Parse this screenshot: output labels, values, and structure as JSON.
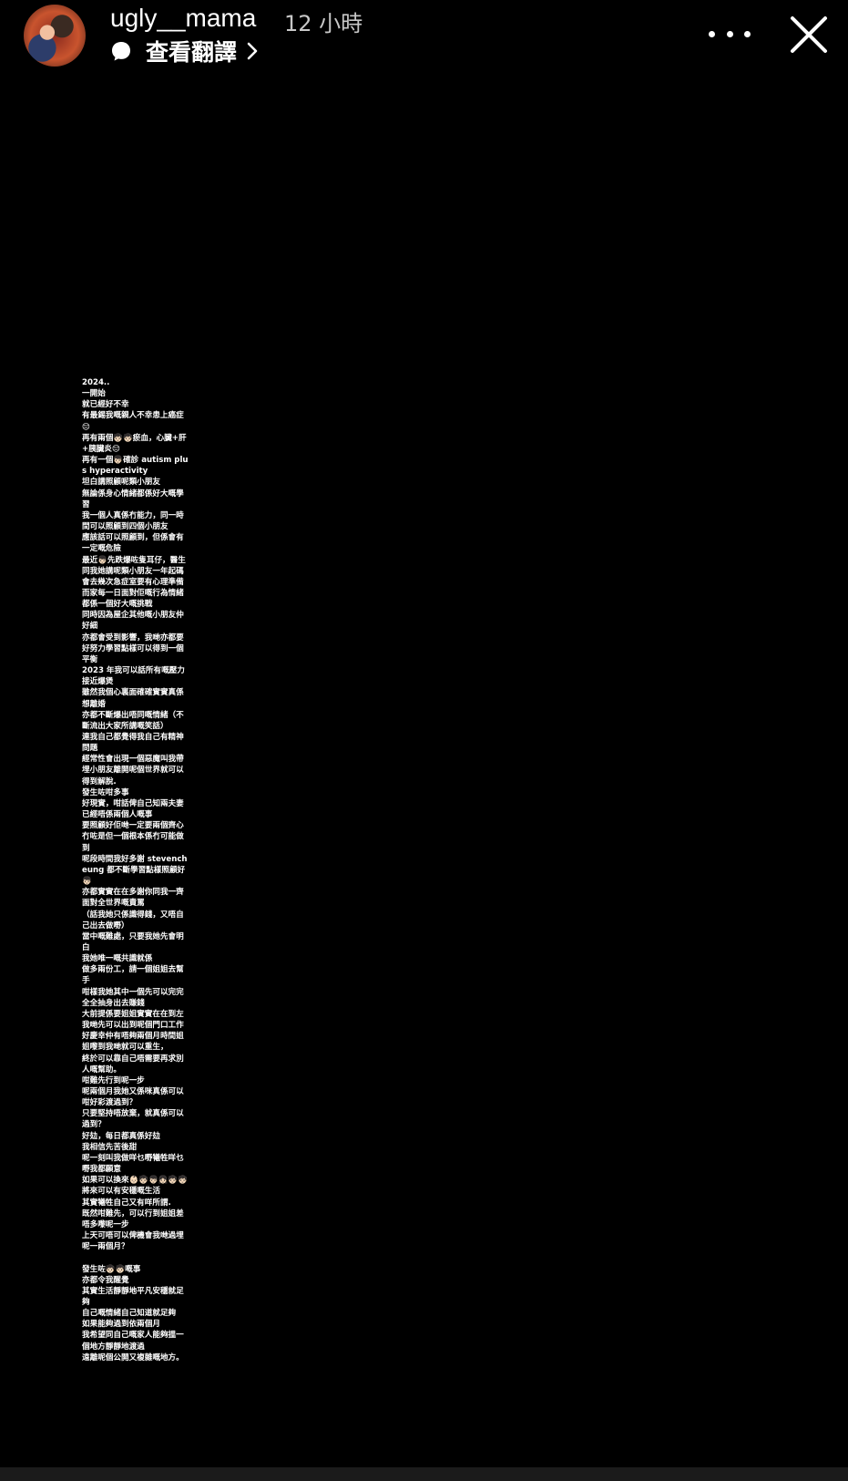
{
  "header": {
    "username": "ugly__mama",
    "time_ago": "12 小時",
    "translate_label": "查看翻譯",
    "icons": {
      "more": "more-horizontal-icon",
      "close": "close-icon",
      "translate": "speech-bubble-icon",
      "chevron": "chevron-right-icon"
    }
  },
  "story": {
    "text": "2024..\n一開始\n就已經好不幸\n有最錫我嘅親人不幸患上癌症😔\n再有兩個🧒🏻🧒🏻瘀血，心臟+肝+胰臟炎😔\n再有一個👦🏻確診 autism plus hyperactivity\n坦白講照顧呢類小朋友\n無論係身心情緒都係好大嘅學習\n我一個人真係冇能力，同一時間可以照顧到四個小朋友\n應該話可以照顧到，但係會有一定嘅危險\n最近👦🏻先跌爆咗隻耳仔，醫生同我她講呢類小朋友一年起碼會去幾次急症室要有心理準備\n而家每一日面對佢嘅行為情緒都係一個好大嘅挑戰\n同時因為屋企其他嘅小朋友仲好細\n亦都會受到影響，我哋亦都要好努力學習點樣可以得到一個平衡\n2023 年我可以話所有嘅壓力接近爆煲\n雖然我個心裏面確確實實真係想離婚\n亦都不斷爆出唔同嘅情緒（不斷流出大家所講嘅笑話）\n連我自己都覺得我自己有精神問題\n經常性會出現一個惡魔叫我帶埋小朋友離開呢個世界就可以得到解脫.\n發生咗咁多事\n好現實，咁話俾自己知兩夫妻已經唔係兩個人嘅事\n要照顧好佢哋一定要兩個齊心\n冇咗是但一個根本係冇可能做到\n呢段時間我好多謝 stevencheung 都不斷學習點樣照顧好👦🏻\n亦都實實在在多謝你同我一齊面對全世界嘅責罵\n（話我她只係識得錢，又唔自己出去做嘢）\n當中嘅難處，只要我她先會明白\n我她唯一嘅共識就係\n做多兩份工，請一個姐姐去幫手\n咁樣我她其中一個先可以完完全全抽身出去賺錢\n大前提係要姐姐實實在在到左\n我哋先可以出到呢個門口工作\n好慶幸仲有唔夠兩個月時間姐姐嚟到我哋就可以重生，\n終於可以靠自己唔需要再求別人嘅幫助。\n咁難先行到呢一步\n呢兩個月我她又係咪真係可以咁好彩渡過到？\n只要堅持唔放棄，就真係可以過到？\n好攰，每日都真係好攰\n我相信先苦後甜\n呢一刻叫我做咩乜嘢犧牲咩乜嘢我都願意\n如果可以換來👶🏻🧒🏻👦🏻👧🏻🧒🏻🧒🏻將來可以有安穩嘅生活\n其實犧牲自己又有咩所謂.\n既然咁難先，可以行到姐姐差唔多嚟呢一步\n上天可唔可以俾機會我哋過埋呢一兩個月？\n\n發生咗🧒🏻🧒🏻嘅事\n亦都令我醒覺\n其實生活靜靜地平凡安穩就足夠\n自己嘅情緒自己知道就足夠\n如果能夠過到依兩個月\n我希望同自己嘅家人能夠搵一個地方靜靜地渡過\n遠離呢個公開又複雜嘅地方。"
  },
  "colors": {
    "background": "#000000",
    "bottom_bar": "#1b1b1b",
    "text": "#ffffff",
    "secondary_text": "#c8c8c8"
  }
}
